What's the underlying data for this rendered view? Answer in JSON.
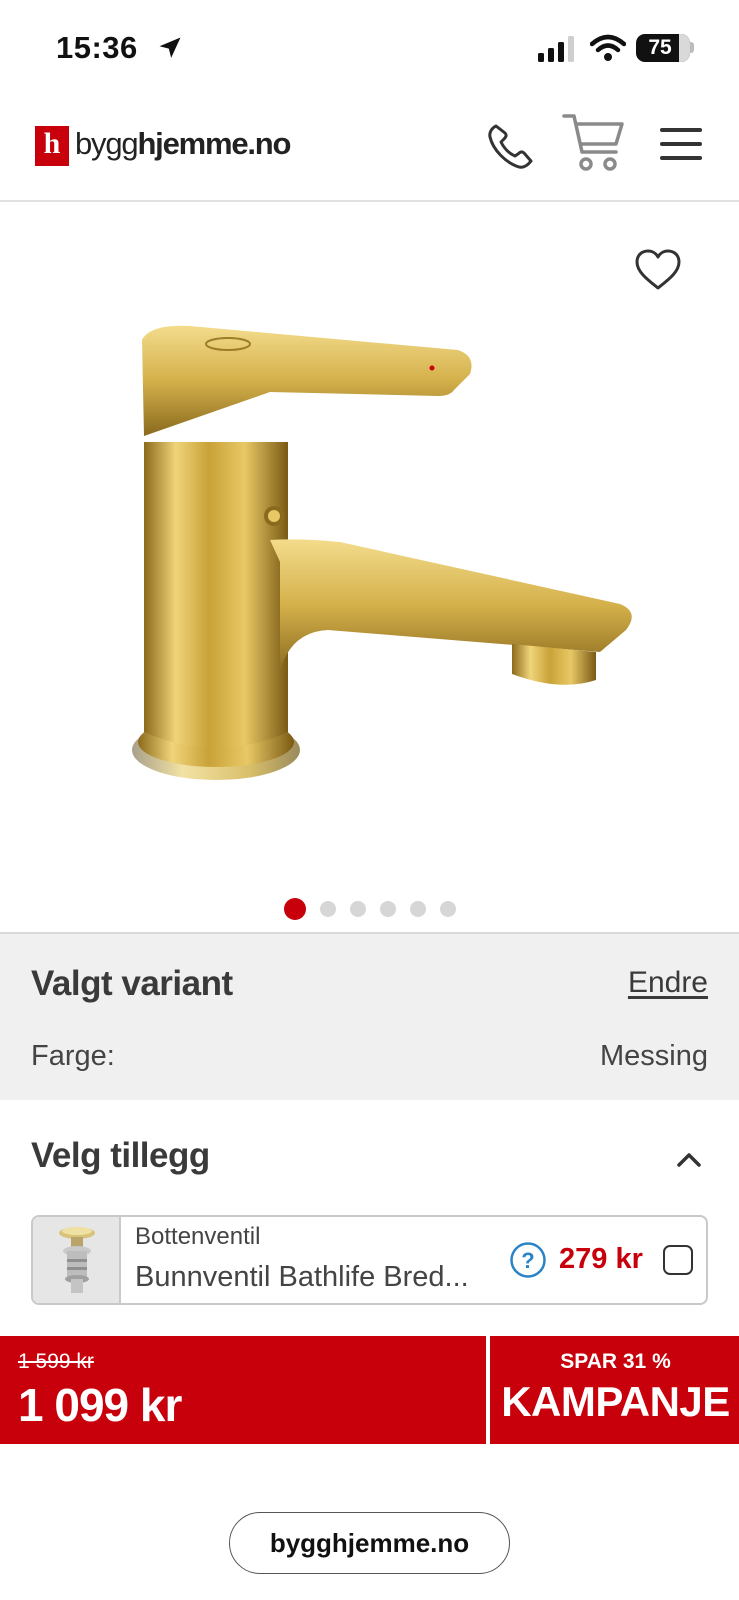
{
  "status_bar": {
    "time": "15:36",
    "battery": "75",
    "icons": [
      "location-arrow-icon",
      "cellular-signal-icon",
      "wifi-icon",
      "battery-icon"
    ]
  },
  "header": {
    "logo_letter": "h",
    "logo_prefix": "bygg",
    "logo_suffix": "hjemme.no",
    "icons": [
      "phone-icon",
      "cart-icon",
      "menu-icon"
    ]
  },
  "gallery": {
    "total_images": 6,
    "active_index": 0,
    "icons": [
      "heart-icon"
    ]
  },
  "variant": {
    "title": "Valgt variant",
    "change_label": "Endre",
    "color_label": "Farge:",
    "color_value": "Messing"
  },
  "addons": {
    "title": "Velg tillegg",
    "items": [
      {
        "category": "Bottenventil",
        "name": "Bunnventil Bathlife Bred...",
        "price": "279 kr",
        "checked": false
      }
    ]
  },
  "price": {
    "old_price": "1 599 kr",
    "new_price": "1 099 kr",
    "save_label": "SPAR 31 %",
    "campaign_label": "KAMPANJE"
  },
  "browser": {
    "url": "bygghjemme.no"
  },
  "colors": {
    "brand_red": "#c8000b",
    "panel_grey": "#f0f0f0",
    "text_dark": "#3a3a3a",
    "info_blue": "#2a84c6"
  }
}
